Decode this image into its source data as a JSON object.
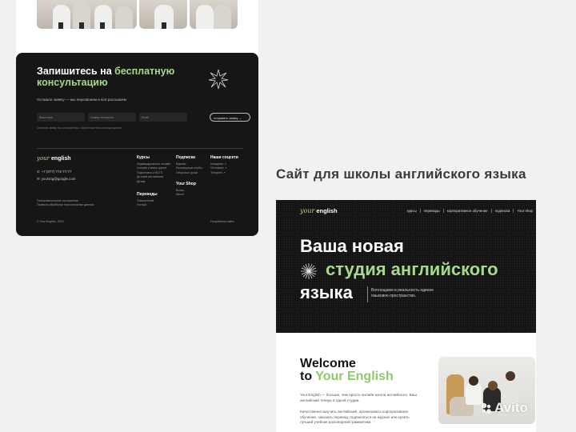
{
  "left_mockup": {
    "cta": {
      "title_part1": "Запишитесь на",
      "title_highlight1": "бесплатную",
      "title_highlight2": "консультацию",
      "subtitle": "Оставьте заявку — мы перезвоним и всё расскажем",
      "name_placeholder": "Ваше имя",
      "phone_placeholder": "Номер телефона",
      "email_placeholder": "Email",
      "submit_label": "отправить заявку →",
      "consent": "Оставляя заявку, вы соглашаетесь с обработкой персональных данных"
    },
    "footer": {
      "logo_italic": "your",
      "logo_bold": "english",
      "phone": "+7 (977) 774-77-77",
      "email": "yoursng@google.com",
      "legal": [
        "Пользовательское соглашение",
        "Правила обработки персональных данных"
      ],
      "copyright": "© Your English, 2022",
      "dev_credit": "Разработка сайта",
      "columns": [
        {
          "heading": "Курсы",
          "items": [
            "Индивидуальные онлайн",
            "Онлайн в мини-группе",
            "Подготовка к IELTS",
            "Детский английский",
            "Детям"
          ]
        },
        {
          "heading": "Переводы",
          "items": [
            "Письменный",
            "Устный"
          ]
        },
        {
          "heading": "Подписка",
          "items": [
            "Единая",
            "Разговорные клубы",
            "Открытые уроки"
          ]
        },
        {
          "heading": "Your Shop",
          "items": [
            "Books",
            "Merch"
          ]
        },
        {
          "heading": "Наши соцсети",
          "items": [
            "Instagram ↗",
            "VKontakte ↗",
            "Telegram ↗"
          ]
        }
      ]
    }
  },
  "section_title": "Сайт для школы английского языка",
  "right_mockup": {
    "header": {
      "logo_italic": "your",
      "logo_bold": "english",
      "nav": [
        "курсы",
        "переводы",
        "корпоративное обучение",
        "подписка",
        "Your shop"
      ]
    },
    "hero": {
      "line1": "Ваша новая",
      "line2": "студия английского",
      "line3": "языка",
      "description": "Воплощаем в реальность единое языковое пространство."
    },
    "welcome": {
      "title_line1": "Welcome",
      "title_to": "to",
      "title_brand": "Your English",
      "para1": "Your English — больше, чем просто онлайн-школа английского. Ваш английский теперь в одной студии.",
      "para2": "Качественно выучить английский, организовать корпоративное обучение, заказать перевод, подписаться на журнал или купить лучший учебник разговорной грамматики."
    }
  },
  "watermark": "Avito",
  "colors": {
    "accent": "#a6d98c",
    "dark": "#141414",
    "background": "#f1f1f1"
  }
}
